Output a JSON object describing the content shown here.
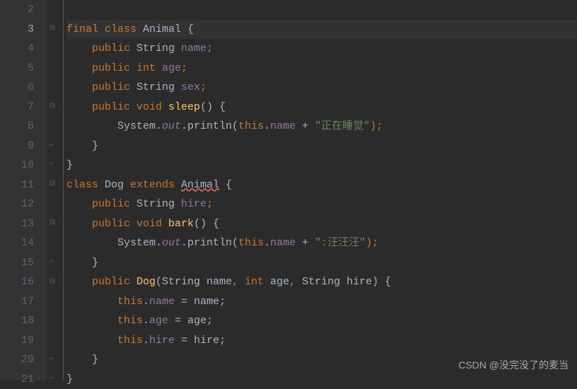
{
  "gutter": {
    "lines": [
      "2",
      "3",
      "4",
      "5",
      "6",
      "7",
      "8",
      "9",
      "10",
      "11",
      "12",
      "13",
      "14",
      "15",
      "16",
      "17",
      "18",
      "19",
      "20",
      "21"
    ],
    "activeLine": "3"
  },
  "code": {
    "l2": "",
    "l3": {
      "t1": "final class ",
      "t2": "Animal ",
      "t3": "{"
    },
    "l4": {
      "t1": "    ",
      "t2": "public ",
      "t3": "String ",
      "t4": "name",
      "t5": ";"
    },
    "l5": {
      "t1": "    ",
      "t2": "public int ",
      "t3": "age",
      "t4": ";"
    },
    "l6": {
      "t1": "    ",
      "t2": "public ",
      "t3": "String ",
      "t4": "sex",
      "t5": ";"
    },
    "l7": {
      "t1": "    ",
      "t2": "public void ",
      "t3": "sleep",
      "t4": "() {"
    },
    "l8": {
      "t1": "        System.",
      "t2": "out",
      "t3": ".println(",
      "t4": "this",
      "t5": ".",
      "t6": "name ",
      "t7": "+ ",
      "t8": "\"正在睡觉\"",
      "t9": ");"
    },
    "l9": {
      "t1": "    }"
    },
    "l10": {
      "t1": "}"
    },
    "l11": {
      "t1": "class ",
      "t2": "Dog ",
      "t3": "extends ",
      "t4": "Animal",
      "t5": " {"
    },
    "l12": {
      "t1": "    ",
      "t2": "public ",
      "t3": "String ",
      "t4": "hire",
      "t5": ";"
    },
    "l13": {
      "t1": "    ",
      "t2": "public void ",
      "t3": "bark",
      "t4": "() {"
    },
    "l14": {
      "t1": "        System.",
      "t2": "out",
      "t3": ".println(",
      "t4": "this",
      "t5": ".",
      "t6": "name ",
      "t7": "+ ",
      "t8": "\":汪汪汪\"",
      "t9": ");"
    },
    "l15": {
      "t1": "    }"
    },
    "l16": {
      "t1": "    ",
      "t2": "public ",
      "t3": "Dog",
      "t4": "(String name",
      "t5": ", ",
      "t6": "int ",
      "t7": "age",
      "t8": ", ",
      "t9": "String hire) {"
    },
    "l17": {
      "t1": "        ",
      "t2": "this",
      "t3": ".",
      "t4": "name ",
      "t5": "= name;"
    },
    "l18": {
      "t1": "        ",
      "t2": "this",
      "t3": ".",
      "t4": "age ",
      "t5": "= age;"
    },
    "l19": {
      "t1": "        ",
      "t2": "this",
      "t3": ".",
      "t4": "hire ",
      "t5": "= hire;"
    },
    "l20": {
      "t1": "    }"
    },
    "l21": {
      "t1": "}"
    }
  },
  "watermark": "CSDN @没完没了的麦当"
}
